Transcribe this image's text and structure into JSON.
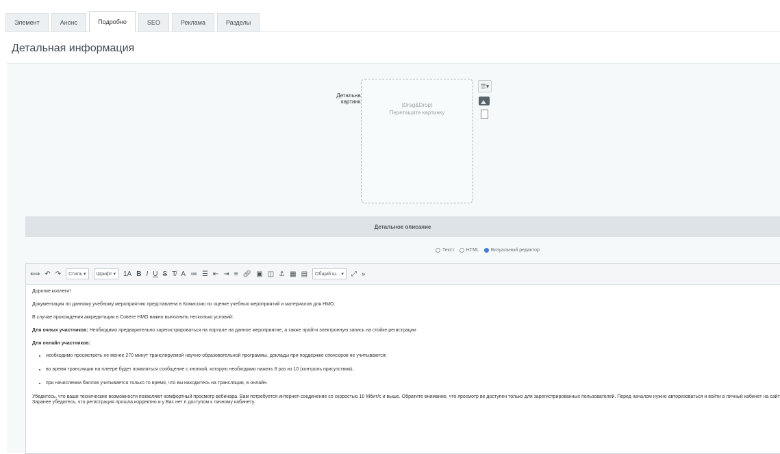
{
  "tabs": [
    {
      "label": "Элемент"
    },
    {
      "label": "Анонс"
    },
    {
      "label": "Подробно"
    },
    {
      "label": "SEO"
    },
    {
      "label": "Реклама"
    },
    {
      "label": "Разделы"
    }
  ],
  "active_tab": "Подробно",
  "section": {
    "title": "Детальная информация"
  },
  "picture": {
    "label": "Детальная картинка",
    "dropzone_line1": "(Drag&Drop)",
    "dropzone_line2": "Перетащите картинку",
    "menu_icon": "list-menu-icon",
    "image_icon": "image-icon",
    "file_icon": "file-icon"
  },
  "description": {
    "title": "Детальное описание",
    "modes": [
      {
        "label": "Текст",
        "checked": false
      },
      {
        "label": "HTML",
        "checked": false
      },
      {
        "label": "Визуальный редактор",
        "checked": true
      }
    ]
  },
  "toolbar": {
    "style_select": "Стиль",
    "font_select": "Шрифт",
    "size_label": "1A",
    "zone_select": "Общий ш..."
  },
  "content": {
    "greeting": "Дорогие коллеги!",
    "p1": "Документация по данному учебному мероприятию представлена в Комиссию по оценке учебных мероприятий и материалов для НМО.",
    "p2": "В случае прохождения аккредитации в Совете НМО важно выполнить несколько условий:",
    "p3_bold": "Для очных участников:",
    "p3_text": " Необходимо предварительно зарегистрироваться на портале на данное мероприятие, а также пройти электронную запись на стойке регистрации",
    "online_heading": "Для онлайн участников:",
    "list": [
      "необходимо просмотреть не менее 270 минут транслируемой научно-образовательной программы, доклады при поддержке спонсоров не учитываются;",
      "во время трансляции на плеере будет появляться сообщение с кнопкой, которую необходимо нажать 8 раз из 10 (контроль присутствия);",
      "при начислении баллов учитывается только то время, что вы находитесь на трансляции, в онлайн."
    ],
    "p_last": "Убедитесь, что ваши технические возможности позволяют комфортный просмотр вебинара. Вам потребуется интернет-соединение со скоростью 10 Мбит/с и выше. Обратите внимание, что просмотр ве доступен только для зарегистрированных пользователей. Перед началом нужно авторизоваться и войти в личный кабинет на сайте. Заранее убедитесь, что регистрация прошла корректно и у Вас нет п доступом к личному кабинету."
  }
}
